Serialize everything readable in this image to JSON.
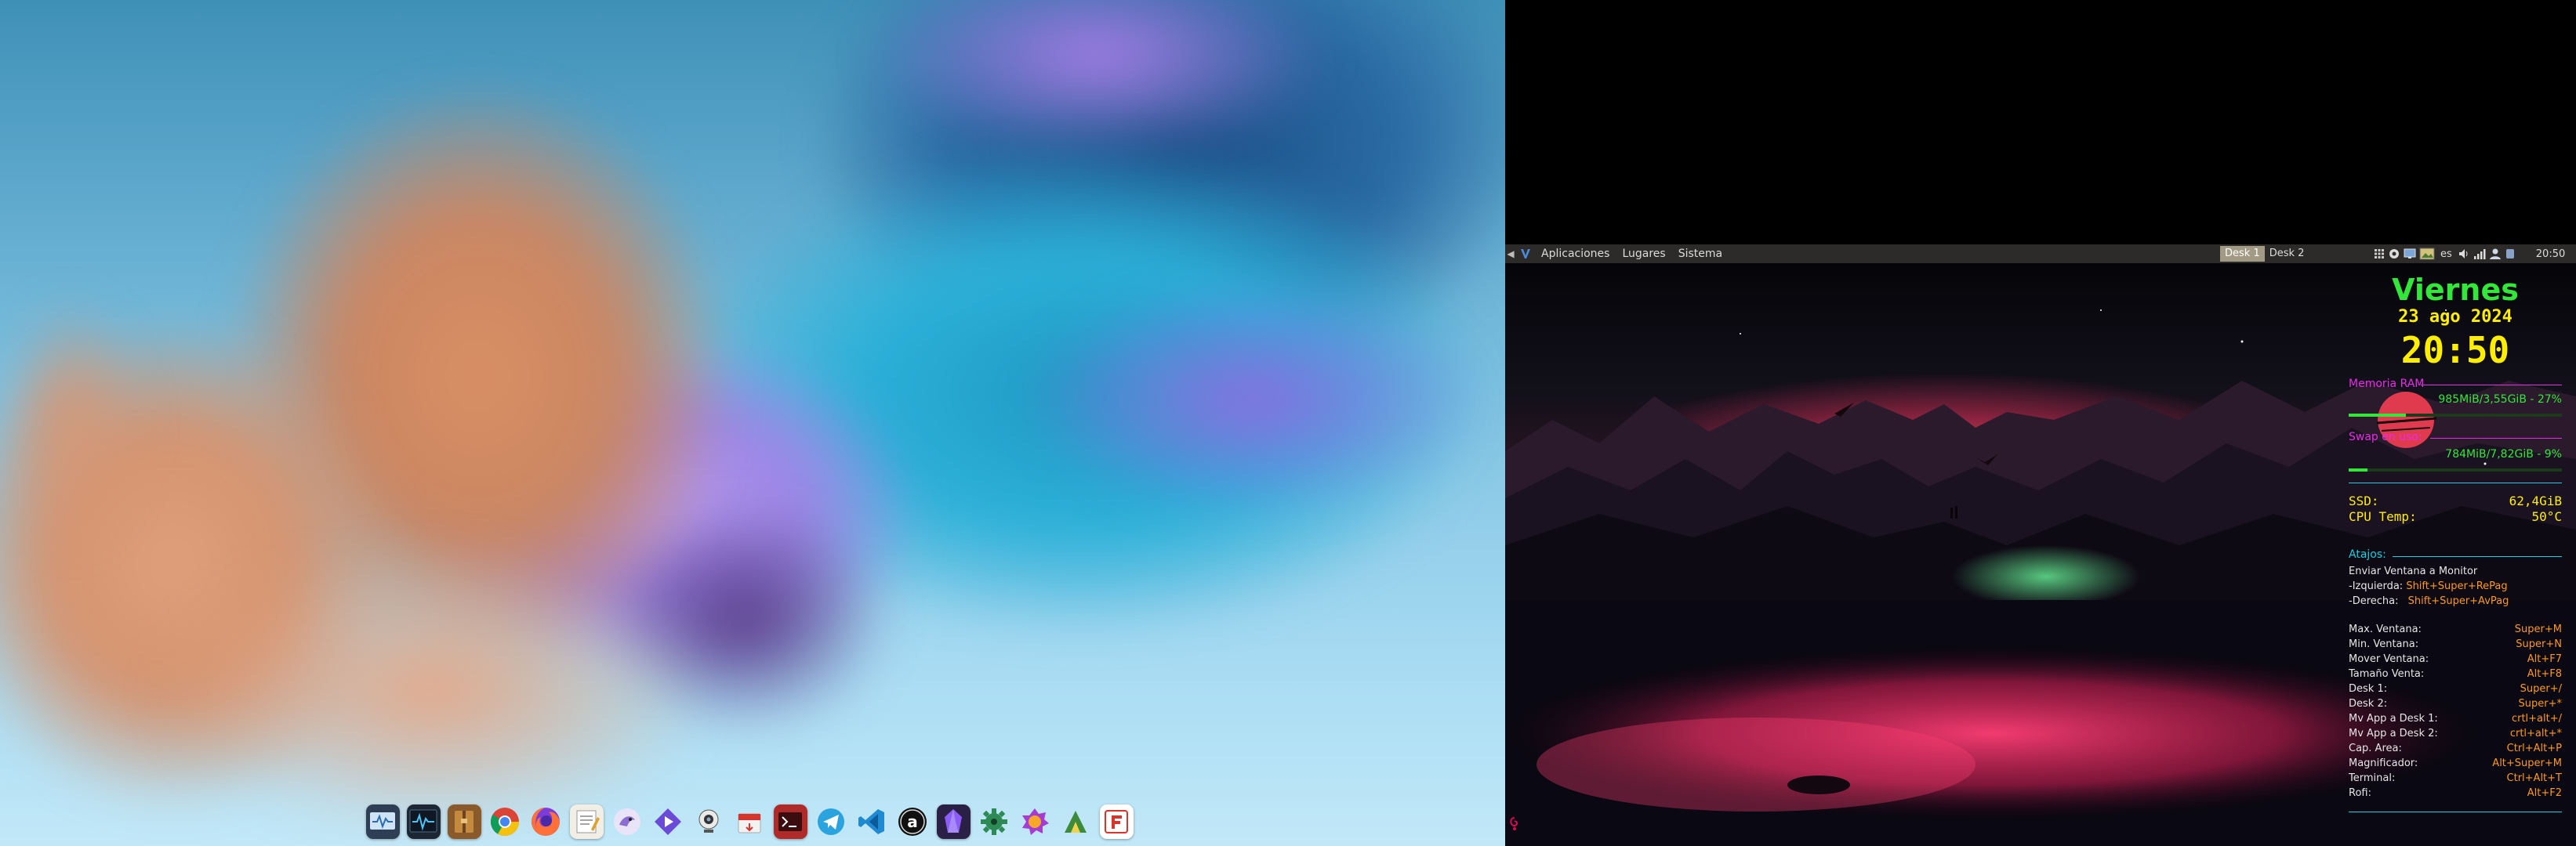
{
  "panel": {
    "menus": [
      "Aplicaciones",
      "Lugares",
      "Sistema"
    ],
    "workspaces": [
      "Desk 1",
      "Desk 2"
    ],
    "active_workspace": "Desk 1",
    "keyboard_layout": "es",
    "clock": "20:50"
  },
  "dock": {
    "icons": [
      "system-monitor-icon",
      "activity-monitor-icon",
      "archive-manager-icon",
      "chrome-icon",
      "firefox-icon",
      "text-editor-icon",
      "bird-app-icon",
      "media-player-icon",
      "webcam-icon",
      "package-installer-icon",
      "terminal-app-icon",
      "telegram-icon",
      "vscode-icon",
      "amazon-icon",
      "obsidian-icon",
      "gear-settings-icon",
      "photo-app-icon",
      "python-idle-icon",
      "flameshot-icon"
    ]
  },
  "conky": {
    "day": "Viernes",
    "date": "23 ago 2024",
    "time": "20:50",
    "ram_label": "Memoria RAM",
    "ram_value": "985MiB/3,55GiB - 27%",
    "ram_percent": 27,
    "swap_label": "Swap en uso:",
    "swap_value": "784MiB/7,82GiB - 9%",
    "swap_percent": 9,
    "ssd_label": "SSD:",
    "ssd_value": "62,4GiB",
    "cpu_label": "CPU Temp:",
    "cpu_value": "50°C",
    "atajos_label": "Atajos:",
    "monitor_header": "Enviar Ventana a Monitor",
    "izquierda_label": "-Izquierda:",
    "izquierda_value": "Shift+Super+RePag",
    "derecha_label": "-Derecha:",
    "derecha_value": "Shift+Super+AvPag",
    "shortcuts": [
      {
        "label": "Max. Ventana:",
        "keys": "Super+M"
      },
      {
        "label": "Min. Ventana:",
        "keys": "Super+N"
      },
      {
        "label": "Mover Ventana:",
        "keys": "Alt+F7"
      },
      {
        "label": "Tamaño Venta:",
        "keys": "Alt+F8"
      },
      {
        "label": "Desk 1:",
        "keys": "Super+/"
      },
      {
        "label": "Desk 2:",
        "keys": "Super+*"
      },
      {
        "label": "Mv App a Desk 1:",
        "keys": "crtl+alt+/"
      },
      {
        "label": "Mv App a Desk 2:",
        "keys": "crtl+alt+*"
      },
      {
        "label": "Cap. Area:",
        "keys": "Ctrl+Alt+P"
      },
      {
        "label": "Magnificador:",
        "keys": "Alt+Super+M"
      },
      {
        "label": "Terminal:",
        "keys": "Ctrl+Alt+T"
      },
      {
        "label": "Rofi:",
        "keys": "Alt+F2"
      }
    ]
  },
  "colors": {
    "conky_green": "#33e63a",
    "conky_yellow": "#ffee00",
    "conky_magenta": "#e62ee6",
    "conky_cyan": "#19cfe0",
    "conky_orange": "#ff9a1a",
    "panel_bg": "#2c2b29"
  }
}
